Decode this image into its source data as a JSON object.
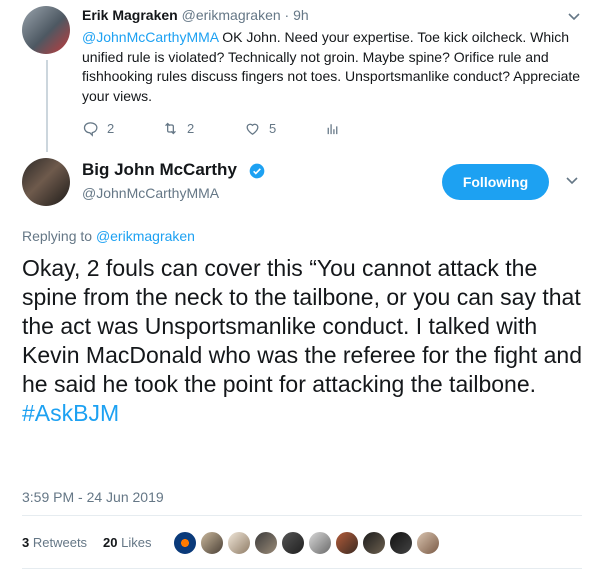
{
  "parent_tweet": {
    "name": "Erik Magraken",
    "handle": "@erikmagraken",
    "time": "· 9h",
    "mention": "@JohnMcCarthyMMA",
    "text": " OK John.  Need your expertise.  Toe kick oilcheck.  Which unified rule is violated?  Technically not groin.  Maybe spine?  Orifice rule and fishhooking rules discuss fingers not toes.  Unsportsmanlike conduct?  Appreciate your views.",
    "replies": "2",
    "retweets": "2",
    "likes": "5"
  },
  "main_tweet": {
    "name": "Big John McCarthy",
    "handle": "@JohnMcCarthyMMA",
    "follow_label": "Following",
    "replying_prefix": "Replying to ",
    "replying_to": "@erikmagraken",
    "text": "Okay, 2 fouls can cover this “You cannot attack the spine from the neck to the tailbone, or you can say that the act was Unsportsmanlike conduct. I talked with Kevin MacDonald who was the referee for the fight and he said he took the point for attacking the tailbone. ",
    "hashtag": "#AskBJM",
    "timestamp": "3:59 PM - 24 Jun 2019",
    "retweet_count": "3",
    "retweet_label": "Retweets",
    "like_count": "20",
    "like_label": "Likes"
  },
  "colors": {
    "accent": "#1da1f2",
    "muted": "#657786",
    "text": "#14171a",
    "border": "#e6ecf0"
  },
  "liker_avatars": [
    "oilers-logo",
    "user-photo",
    "user-photo",
    "user-photo",
    "user-photo",
    "user-photo",
    "user-photo",
    "user-photo",
    "user-photo",
    "user-photo"
  ]
}
